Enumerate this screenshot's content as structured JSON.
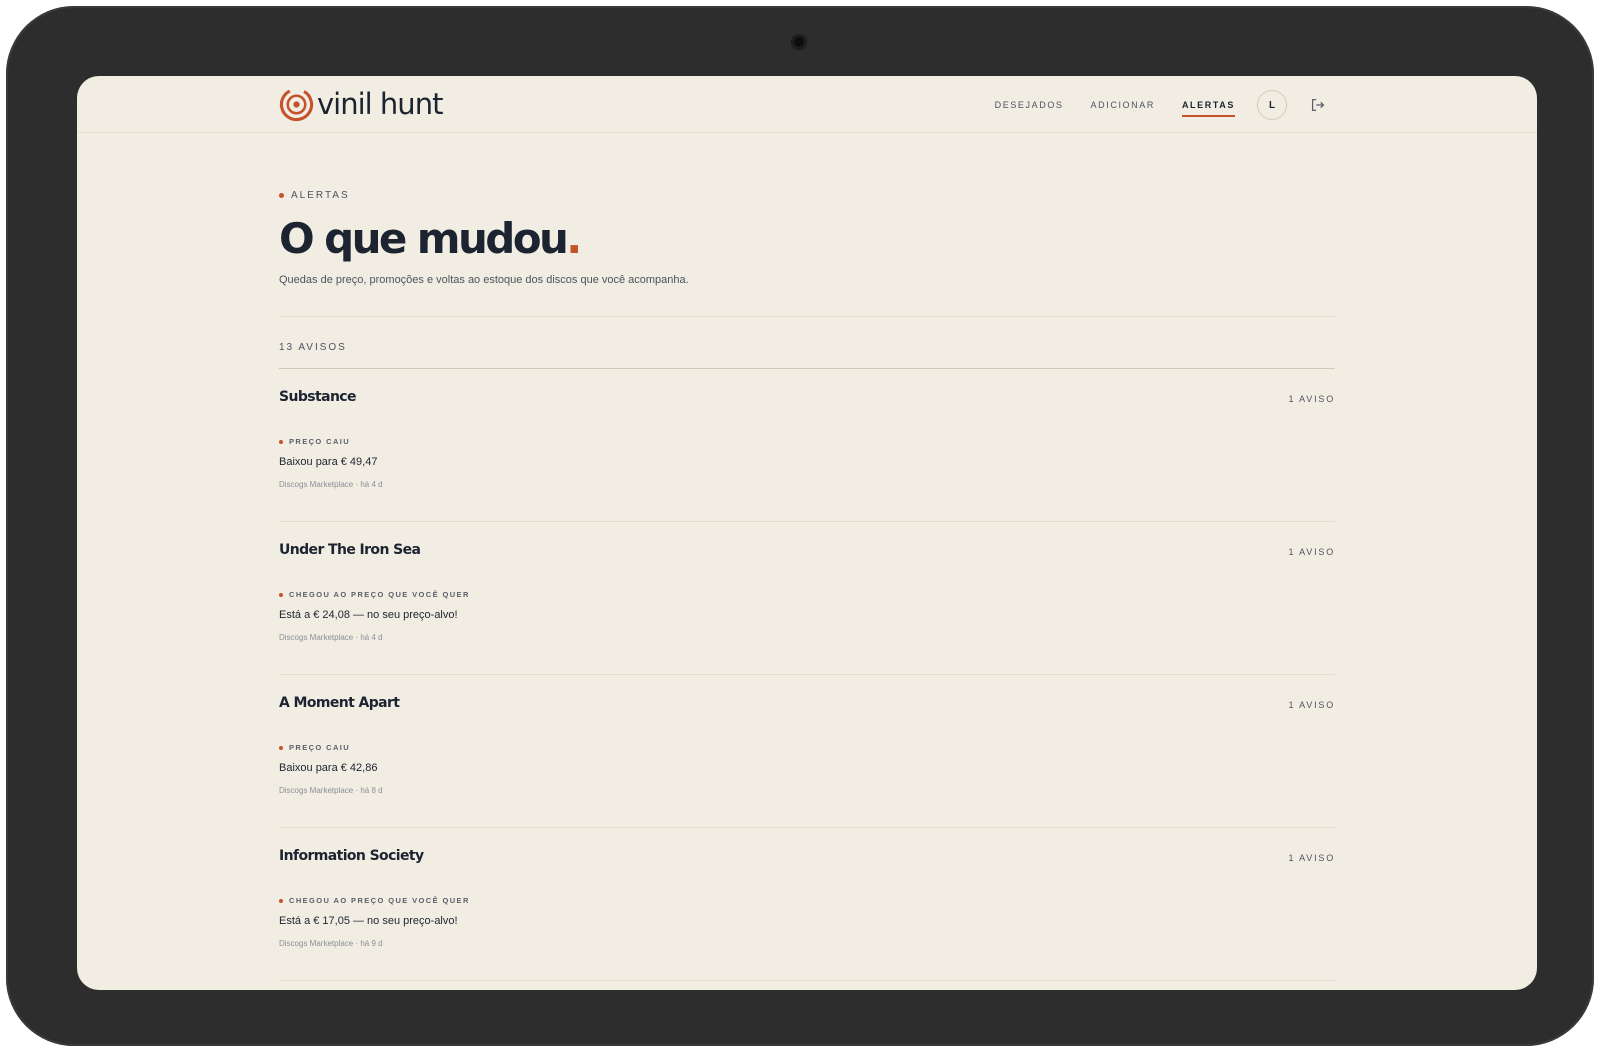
{
  "brand": {
    "name": "vinil hunt",
    "accent": "#c4532b"
  },
  "nav": {
    "items": [
      {
        "label": "DESEJADOS"
      },
      {
        "label": "ADICIONAR"
      },
      {
        "label": "ALERTAS",
        "active": true
      }
    ],
    "avatar_initial": "L",
    "logout_icon": "logout-icon"
  },
  "page": {
    "eyebrow": "ALERTAS",
    "title": "O que mudou",
    "title_dot": ".",
    "subtitle": "Quedas de preço, promoções e voltas ao estoque dos discos que você acompanha.",
    "count_label": "13 AVISOS"
  },
  "alerts": [
    {
      "title": "Substance",
      "count": "1 AVISO",
      "type": "PREÇO CAIU",
      "message": "Baixou para € 49,47",
      "meta": "Discogs Marketplace · há 4 d"
    },
    {
      "title": "Under The Iron Sea",
      "count": "1 AVISO",
      "type": "CHEGOU AO PREÇO QUE VOCÊ QUER",
      "message": "Está a € 24,08 — no seu preço-alvo!",
      "meta": "Discogs Marketplace · há 4 d"
    },
    {
      "title": "A Moment Apart",
      "count": "1 AVISO",
      "type": "PREÇO CAIU",
      "message": "Baixou para € 42,86",
      "meta": "Discogs Marketplace · há 8 d"
    },
    {
      "title": "Information Society",
      "count": "1 AVISO",
      "type": "CHEGOU AO PREÇO QUE VOCÊ QUER",
      "message": "Está a € 17,05 — no seu preço-alvo!",
      "meta": "Discogs Marketplace · há 9 d"
    }
  ]
}
